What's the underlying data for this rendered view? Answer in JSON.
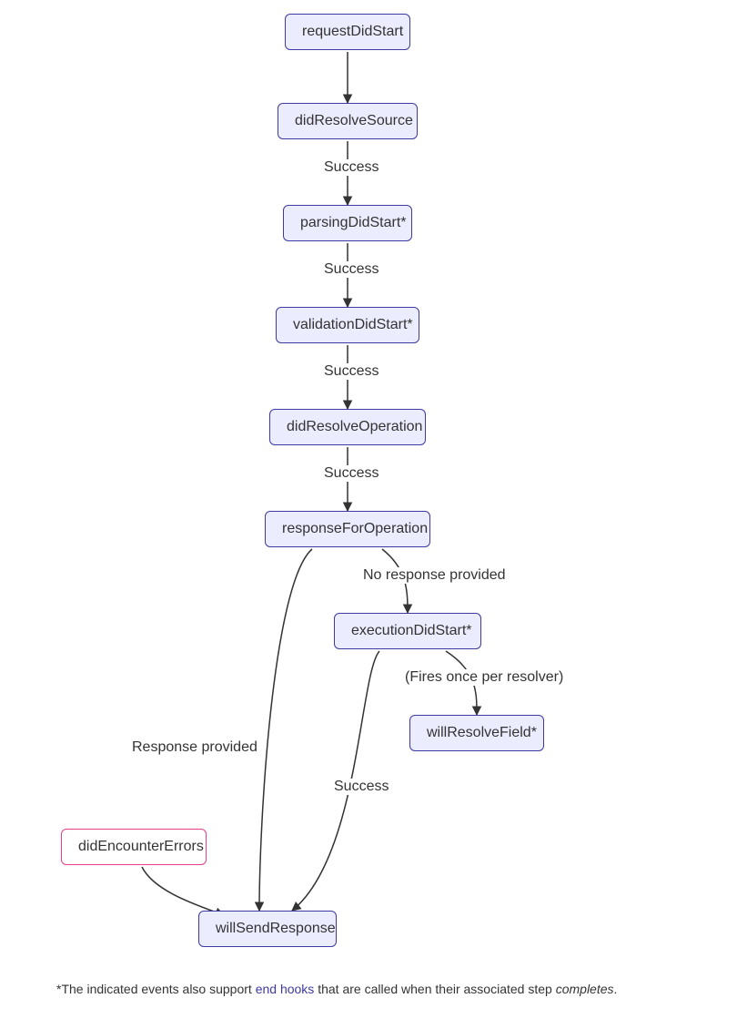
{
  "diagram": {
    "nodes": {
      "requestDidStart": {
        "label": "requestDidStart"
      },
      "didResolveSource": {
        "label": "didResolveSource"
      },
      "parsingDidStart": {
        "label": "parsingDidStart*"
      },
      "validationDidStart": {
        "label": "validationDidStart*"
      },
      "didResolveOperation": {
        "label": "didResolveOperation"
      },
      "responseForOperation": {
        "label": "responseForOperation"
      },
      "executionDidStart": {
        "label": "executionDidStart*"
      },
      "willResolveField": {
        "label": "willResolveField*"
      },
      "didEncounterErrors": {
        "label": "didEncounterErrors"
      },
      "willSendResponse": {
        "label": "willSendResponse"
      }
    },
    "edges": {
      "e1": {
        "from": "requestDidStart",
        "to": "didResolveSource",
        "label": ""
      },
      "e2": {
        "from": "didResolveSource",
        "to": "parsingDidStart",
        "label": "Success"
      },
      "e3": {
        "from": "parsingDidStart",
        "to": "validationDidStart",
        "label": "Success"
      },
      "e4": {
        "from": "validationDidStart",
        "to": "didResolveOperation",
        "label": "Success"
      },
      "e5": {
        "from": "didResolveOperation",
        "to": "responseForOperation",
        "label": "Success"
      },
      "e6": {
        "from": "responseForOperation",
        "to": "willSendResponse",
        "label": "Response provided"
      },
      "e7": {
        "from": "responseForOperation",
        "to": "executionDidStart",
        "label": "No response provided"
      },
      "e8": {
        "from": "executionDidStart",
        "to": "willResolveField",
        "label": "(Fires once per resolver)"
      },
      "e9": {
        "from": "executionDidStart",
        "to": "willSendResponse",
        "label": "Success"
      },
      "e10": {
        "from": "didEncounterErrors",
        "to": "willSendResponse",
        "label": ""
      }
    }
  },
  "footnote": {
    "prefix": "*The indicated events also support ",
    "link": "end hooks",
    "suffix": " that are called when their associated step ",
    "em": "completes",
    "tail": "."
  },
  "colors": {
    "nodeFill": "#ECECFF",
    "nodeBorder": "#3F3AA3",
    "errorBorder": "#e83e8c",
    "edge": "#333333"
  }
}
